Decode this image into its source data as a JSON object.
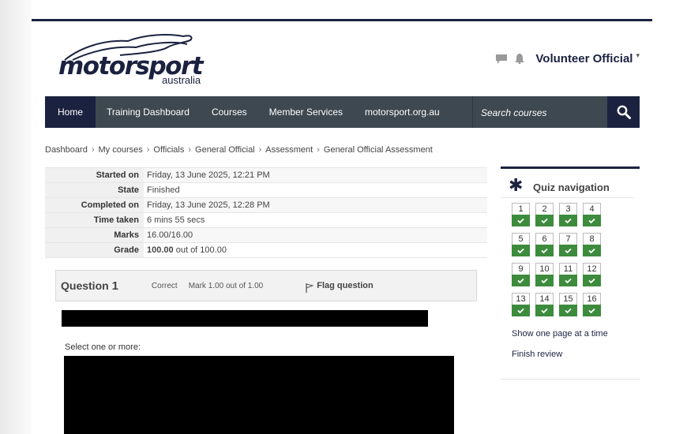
{
  "header": {
    "logo_main": "motorsport",
    "logo_sub": "australia",
    "user_name": "Volunteer Official"
  },
  "nav": {
    "items": [
      "Home",
      "Training Dashboard",
      "Courses",
      "Member Services",
      "motorsport.org.au"
    ],
    "search_placeholder": "Search courses"
  },
  "breadcrumb": [
    "Dashboard",
    "My courses",
    "Officials",
    "General Official",
    "Assessment",
    "General Official Assessment"
  ],
  "summary": {
    "rows": [
      {
        "label": "Started on",
        "value": "Friday, 13 June 2025, 12:21 PM"
      },
      {
        "label": "State",
        "value": "Finished"
      },
      {
        "label": "Completed on",
        "value": "Friday, 13 June 2025, 12:28 PM"
      },
      {
        "label": "Time taken",
        "value": "6 mins 55 secs"
      },
      {
        "label": "Marks",
        "value": "16.00/16.00"
      }
    ],
    "grade_label": "Grade",
    "grade_value": "100.00",
    "grade_suffix": "out of 100.00"
  },
  "question": {
    "label": "Question",
    "number": "1",
    "state": "Correct",
    "grade": "Mark 1.00 out of 1.00",
    "flag_label": "Flag question",
    "prompt": "Select one or more:"
  },
  "quiz_nav": {
    "title": "Quiz navigation",
    "questions": [
      "1",
      "2",
      "3",
      "4",
      "5",
      "6",
      "7",
      "8",
      "9",
      "10",
      "11",
      "12",
      "13",
      "14",
      "15",
      "16"
    ],
    "links": [
      "Show one page at a time",
      "Finish review"
    ]
  },
  "colors": {
    "navy": "#1b2240",
    "nav_bg": "#3d4850",
    "correct_green": "#3d8b3d"
  }
}
